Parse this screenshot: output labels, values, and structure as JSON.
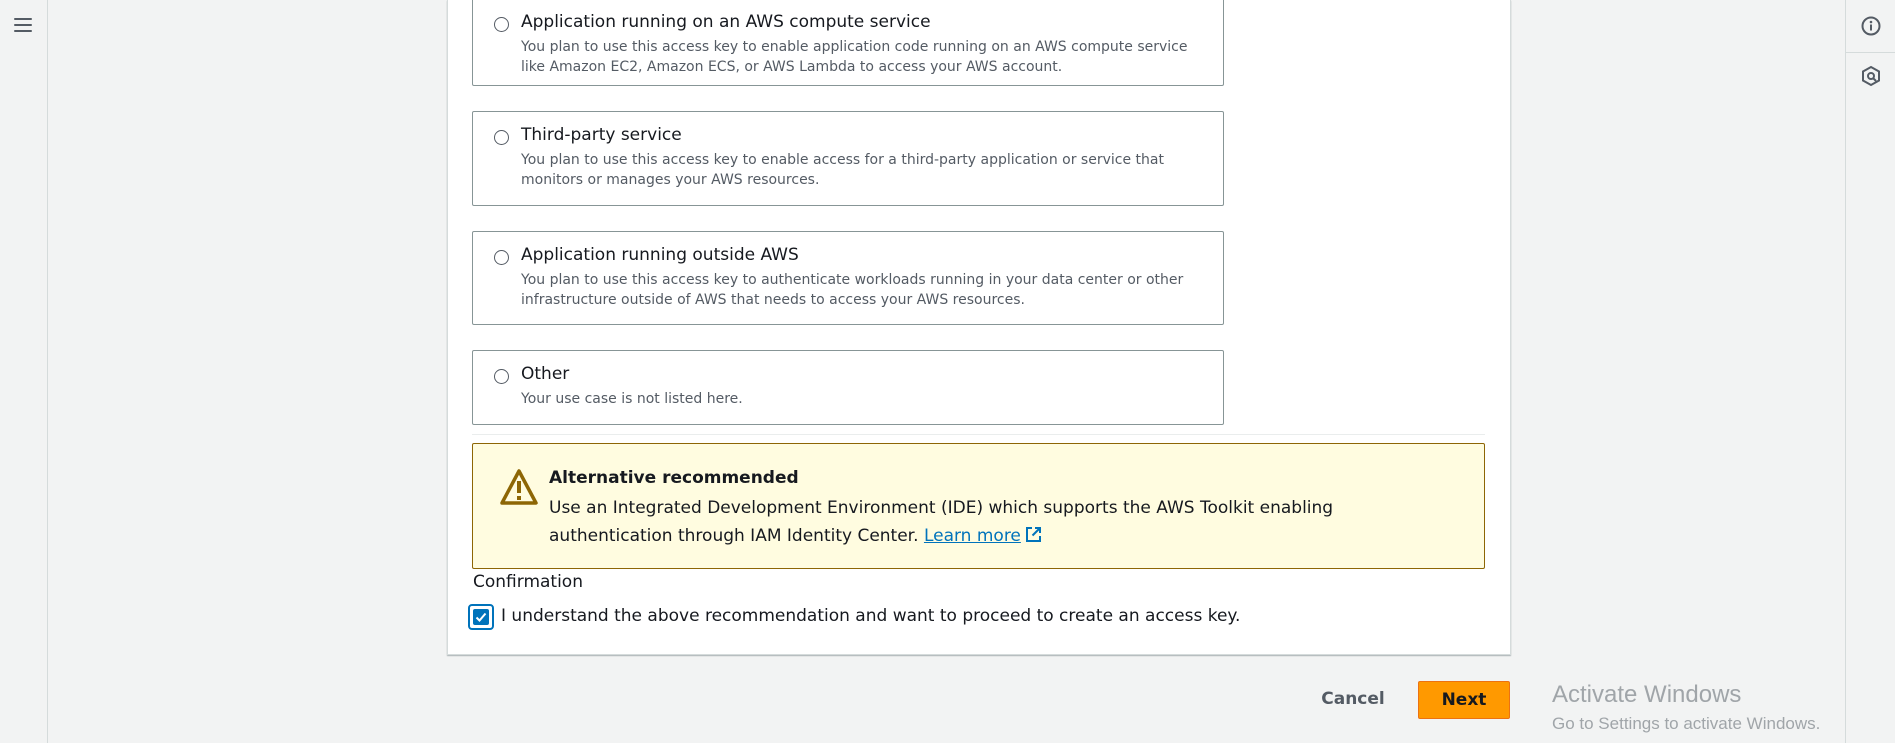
{
  "options": [
    {
      "title": "Application running on an AWS compute service",
      "description": "You plan to use this access key to enable application code running on an AWS compute service like Amazon EC2, Amazon ECS, or AWS Lambda to access your AWS account."
    },
    {
      "title": "Third-party service",
      "description": "You plan to use this access key to enable access for a third-party application or service that monitors or manages your AWS resources."
    },
    {
      "title": "Application running outside AWS",
      "description": "You plan to use this access key to authenticate workloads running in your data center or other infrastructure outside of AWS that needs to access your AWS resources."
    },
    {
      "title": "Other",
      "description": "Your use case is not listed here."
    }
  ],
  "alert": {
    "title": "Alternative recommended",
    "body": "Use an Integrated Development Environment (IDE) which supports the AWS Toolkit enabling authentication through IAM Identity Center.",
    "link_label": "Learn more"
  },
  "confirmation": {
    "label": "Confirmation",
    "checkbox_text": "I understand the above recommendation and want to proceed to create an access key.",
    "checked": true
  },
  "actions": {
    "cancel_label": "Cancel",
    "next_label": "Next"
  },
  "watermark": {
    "title": "Activate Windows",
    "subtitle": "Go to Settings to activate Windows."
  },
  "icons": {
    "menu": "hamburger-menu-icon",
    "info": "info-icon",
    "settings": "hexagon-settings-icon",
    "warning": "warning-triangle-icon",
    "external": "external-link-icon",
    "check": "checkmark-icon"
  },
  "colors": {
    "accent": "#0073bb",
    "primary_button": "#ff9900",
    "alert_background": "#fffce0",
    "alert_border": "#8d6605"
  }
}
